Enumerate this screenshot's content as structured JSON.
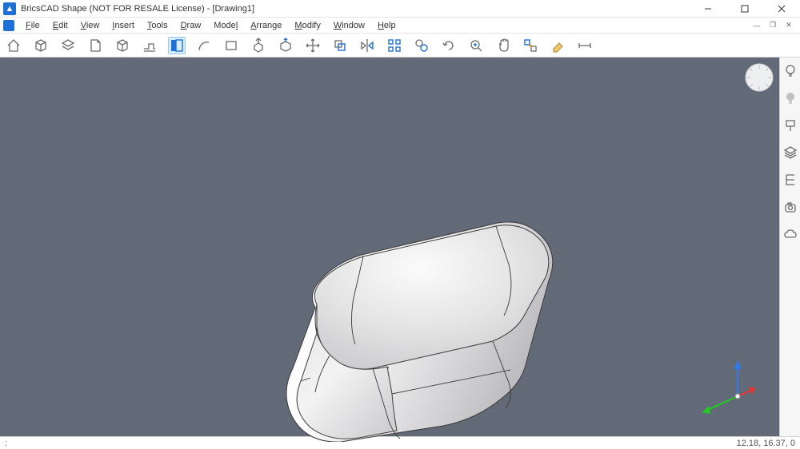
{
  "window": {
    "title": "BricsCAD Shape (NOT FOR RESALE License) - [Drawing1]"
  },
  "menubar": {
    "items": [
      {
        "label": "File",
        "accel": "F"
      },
      {
        "label": "Edit",
        "accel": "E"
      },
      {
        "label": "View",
        "accel": "V"
      },
      {
        "label": "Insert",
        "accel": "I"
      },
      {
        "label": "Tools",
        "accel": "T"
      },
      {
        "label": "Draw",
        "accel": "D"
      },
      {
        "label": "Model",
        "accel": "l"
      },
      {
        "label": "Arrange",
        "accel": "A"
      },
      {
        "label": "Modify",
        "accel": "M"
      },
      {
        "label": "Window",
        "accel": "W"
      },
      {
        "label": "Help",
        "accel": "H"
      }
    ]
  },
  "toolbar": {
    "items": [
      {
        "name": "home",
        "active": false
      },
      {
        "name": "box",
        "active": false
      },
      {
        "name": "layers",
        "active": false
      },
      {
        "name": "page",
        "active": false
      },
      {
        "name": "cube",
        "active": false
      },
      {
        "name": "profile",
        "active": false
      },
      {
        "name": "section",
        "active": true
      },
      {
        "name": "arc-tool",
        "active": false
      },
      {
        "name": "rect-tool",
        "active": false
      },
      {
        "name": "extrude",
        "active": false
      },
      {
        "name": "push-pull",
        "active": false
      },
      {
        "name": "move",
        "active": false
      },
      {
        "name": "copy",
        "active": false
      },
      {
        "name": "mirror",
        "active": false
      },
      {
        "name": "array",
        "active": false
      },
      {
        "name": "align",
        "active": false
      },
      {
        "name": "rotate",
        "active": false
      },
      {
        "name": "zoom-fit",
        "active": false
      },
      {
        "name": "pan",
        "active": false
      },
      {
        "name": "snap",
        "active": false
      },
      {
        "name": "eraser",
        "active": false
      },
      {
        "name": "measure",
        "active": false
      }
    ]
  },
  "right_panel": {
    "items": [
      {
        "name": "light-bulb"
      },
      {
        "name": "light-bulb-filled"
      },
      {
        "name": "paint"
      },
      {
        "name": "layers-stack"
      },
      {
        "name": "structure"
      },
      {
        "name": "camera"
      },
      {
        "name": "cloud"
      }
    ]
  },
  "statusbar": {
    "left": ":",
    "coords": "12.18, 16.37, 0"
  }
}
